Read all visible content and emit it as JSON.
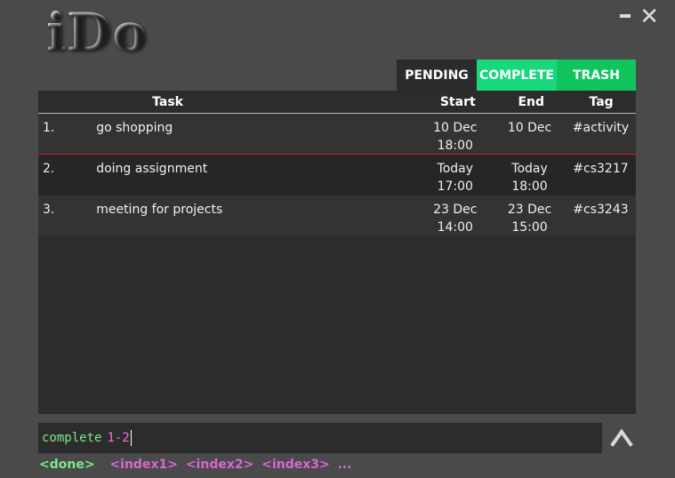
{
  "app": {
    "logo": "iDo"
  },
  "window_controls": {
    "minimize": "–",
    "close": "✕"
  },
  "tabs": [
    {
      "label": "PENDING"
    },
    {
      "label": "COMPLETE"
    },
    {
      "label": "TRASH"
    }
  ],
  "table": {
    "headers": {
      "task": "Task",
      "start": "Start",
      "end": "End",
      "tag": "Tag"
    },
    "rows": [
      {
        "num": "1.",
        "task": "go shopping",
        "start_date": "10 Dec",
        "start_time": "18:00",
        "end_date": "10 Dec",
        "end_time": "",
        "tag": "#activity"
      },
      {
        "num": "2.",
        "task": "doing assignment",
        "start_date": "Today",
        "start_time": "17:00",
        "end_date": "Today",
        "end_time": "18:00",
        "tag": "#cs3217"
      },
      {
        "num": "3.",
        "task": "meeting for projects",
        "start_date": "23 Dec",
        "start_time": "14:00",
        "end_date": "23 Dec",
        "end_time": "15:00",
        "tag": "#cs3243"
      }
    ]
  },
  "command_input": {
    "command": "complete",
    "argument": "1-2"
  },
  "hints": {
    "done": "<done>",
    "args": [
      "<index1>",
      "<index2>",
      "<index3>",
      "..."
    ]
  },
  "colors": {
    "accent_green": "#19d77b",
    "command_green": "#7ee68a",
    "argument_pink": "#f26cd9",
    "selected_row_border": "#d02020"
  }
}
